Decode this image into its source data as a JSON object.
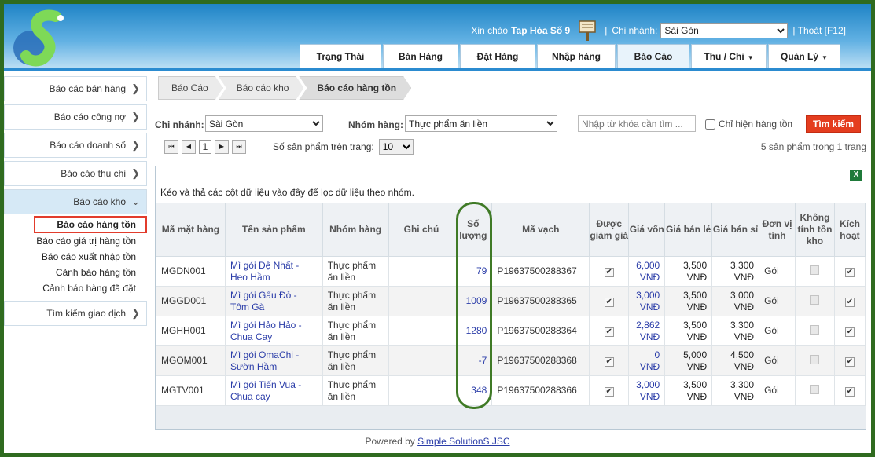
{
  "header": {
    "greeting": "Xin chào",
    "store_name": "Tap Hóa Số 9",
    "branch_label": "Chi nhánh:",
    "branch_value": "Sài Gòn",
    "logout": "| Thoát [F12]",
    "separator": "|"
  },
  "tabs": [
    "Trạng Thái",
    "Bán Hàng",
    "Đặt Hàng",
    "Nhập hàng",
    "Báo Cáo",
    "Thu / Chi",
    "Quản Lý"
  ],
  "sidebar": {
    "items": [
      "Báo cáo bán hàng",
      "Báo cáo công nợ",
      "Báo cáo doanh số",
      "Báo cáo thu chi",
      "Báo cáo kho",
      "Tìm kiếm giao dịch"
    ],
    "subitems": [
      "Báo cáo hàng tồn",
      "Báo cáo giá trị hàng tồn",
      "Báo cáo xuất nhập tồn",
      "Cảnh báo hàng tồn",
      "Cảnh báo hàng đã đặt"
    ]
  },
  "breadcrumb": [
    "Báo Cáo",
    "Báo cáo kho",
    "Báo cáo hàng tồn"
  ],
  "filters": {
    "branch_label": "Chi nhánh:",
    "branch_value": "Sài Gòn",
    "group_label": "Nhóm hàng:",
    "group_value": "Thực phẩm ăn liền",
    "keyword_placeholder": "Nhập từ khóa cần tìm ...",
    "stock_only_label": "Chỉ hiện hàng tồn",
    "search_button": "Tìm kiếm"
  },
  "pager": {
    "page": "1",
    "page_size_label": "Số sản phẩm trên trang:",
    "page_size": "10",
    "info": "5 sản phẩm trong 1 trang"
  },
  "grid": {
    "group_hint": "Kéo và thả các cột dữ liệu vào đây để lọc dữ liệu theo nhóm.",
    "columns": [
      "Mã mặt hàng",
      "Tên sản phẩm",
      "Nhóm hàng",
      "Ghi chú",
      "Số lượng",
      "Mã vạch",
      "Được giảm giá",
      "Giá vốn",
      "Giá bán lẻ",
      "Giá bán sỉ",
      "Đơn vị tính",
      "Không tính tồn kho",
      "Kích hoạt"
    ],
    "rows": [
      {
        "code": "MGDN001",
        "name": "Mì gói Đệ Nhất - Heo Hầm",
        "group": "Thực phẩm ăn liền",
        "note": "",
        "qty": "79",
        "barcode": "P19637500288367",
        "discount": true,
        "cost": "6,000 VNĐ",
        "retail": "3,500 VNĐ",
        "wholesale": "3,300 VNĐ",
        "unit": "Gói",
        "no_stock": false,
        "active": true
      },
      {
        "code": "MGGD001",
        "name": "Mì gói Gấu Đỏ - Tôm Gà",
        "group": "Thực phẩm ăn liền",
        "note": "",
        "qty": "1009",
        "barcode": "P19637500288365",
        "discount": true,
        "cost": "3,000 VNĐ",
        "retail": "3,500 VNĐ",
        "wholesale": "3,000 VNĐ",
        "unit": "Gói",
        "no_stock": false,
        "active": true
      },
      {
        "code": "MGHH001",
        "name": "Mì gói Hảo Hảo - Chua Cay",
        "group": "Thực phẩm ăn liền",
        "note": "",
        "qty": "1280",
        "barcode": "P19637500288364",
        "discount": true,
        "cost": "2,862 VNĐ",
        "retail": "3,500 VNĐ",
        "wholesale": "3,300 VNĐ",
        "unit": "Gói",
        "no_stock": false,
        "active": true
      },
      {
        "code": "MGOM001",
        "name": "Mì gói OmaChi - Sườn Hầm",
        "group": "Thực phẩm ăn liền",
        "note": "",
        "qty": "-7",
        "barcode": "P19637500288368",
        "discount": true,
        "cost": "0 VNĐ",
        "retail": "5,000 VNĐ",
        "wholesale": "4,500 VNĐ",
        "unit": "Gói",
        "no_stock": false,
        "active": true
      },
      {
        "code": "MGTV001",
        "name": "Mì gói Tiến Vua - Chua cay",
        "group": "Thực phẩm ăn liền",
        "note": "",
        "qty": "348",
        "barcode": "P19637500288366",
        "discount": true,
        "cost": "3,000 VNĐ",
        "retail": "3,500 VNĐ",
        "wholesale": "3,300 VNĐ",
        "unit": "Gói",
        "no_stock": false,
        "active": true
      }
    ]
  },
  "footer": {
    "powered": "Powered by",
    "company": "Simple SolutionS JSC"
  },
  "colors": {
    "frame": "#2f6b1f",
    "header": "#1f84c6",
    "accent": "#e43d1f",
    "link": "#2a3ca8",
    "highlight_box": "#e23c2c",
    "oval": "#3f7a26"
  }
}
